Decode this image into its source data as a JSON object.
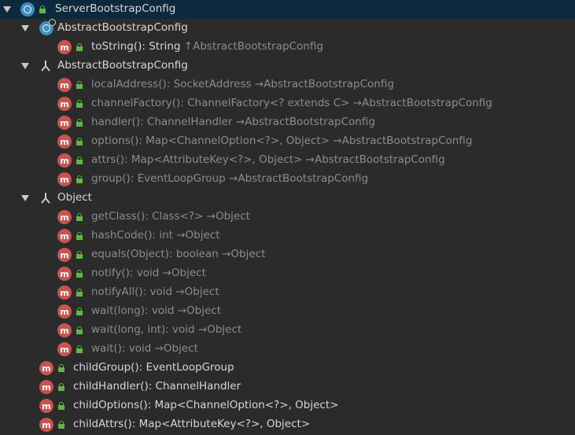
{
  "root": {
    "label": "ServerBootstrapConfig"
  },
  "groups": [
    {
      "label": "AbstractBootstrapConfig",
      "kind": "class",
      "items": [
        {
          "label": "toString(): String ",
          "suffix": "↑AbstractBootstrapConfig"
        }
      ]
    },
    {
      "label": "AbstractBootstrapConfig",
      "kind": "inherited",
      "items": [
        {
          "label": "localAddress(): SocketAddress →AbstractBootstrapConfig"
        },
        {
          "label": "channelFactory(): ChannelFactory<? extends C> →AbstractBootstrapConfig"
        },
        {
          "label": "handler(): ChannelHandler →AbstractBootstrapConfig"
        },
        {
          "label": "options(): Map<ChannelOption<?>, Object> →AbstractBootstrapConfig"
        },
        {
          "label": "attrs(): Map<AttributeKey<?>, Object> →AbstractBootstrapConfig"
        },
        {
          "label": "group(): EventLoopGroup →AbstractBootstrapConfig"
        }
      ]
    },
    {
      "label": "Object",
      "kind": "inherited",
      "items": [
        {
          "label": "getClass(): Class<?> →Object"
        },
        {
          "label": "hashCode(): int →Object"
        },
        {
          "label": "equals(Object): boolean →Object"
        },
        {
          "label": "notify(): void →Object"
        },
        {
          "label": "notifyAll(): void →Object"
        },
        {
          "label": "wait(long): void →Object"
        },
        {
          "label": "wait(long, int): void →Object"
        },
        {
          "label": "wait(): void →Object"
        }
      ]
    }
  ],
  "own_methods": [
    {
      "label": "childGroup(): EventLoopGroup"
    },
    {
      "label": "childHandler(): ChannelHandler"
    },
    {
      "label": "childOptions(): Map<ChannelOption<?>, Object>"
    },
    {
      "label": "childAttrs(): Map<AttributeKey<?>, Object>"
    }
  ],
  "icons": {
    "method": "m",
    "class": "c"
  },
  "colors": {
    "background": "#2b2b2b",
    "selected_row": "#0d293e",
    "method_icon": "#c75450",
    "class_icon": "#3d8fbf",
    "lock": "#62b543",
    "text_dim": "#8c8c8c",
    "text_bright": "#d6d6d6"
  }
}
